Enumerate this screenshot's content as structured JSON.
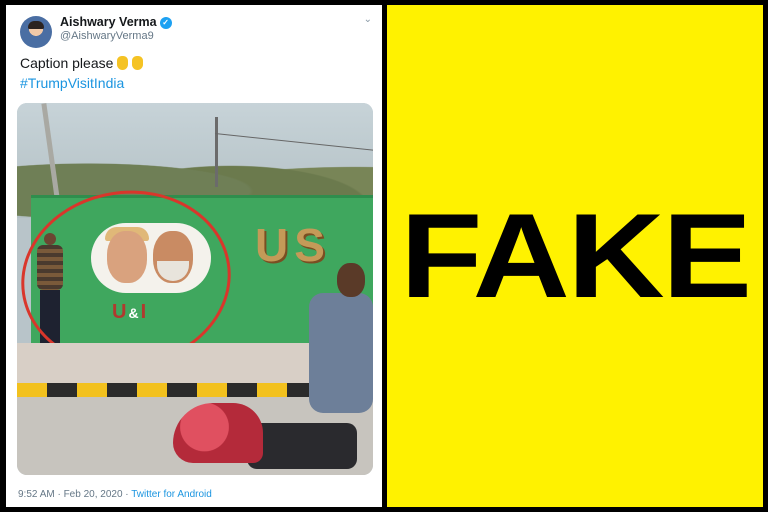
{
  "tweet": {
    "display_name": "Aishwary Verma",
    "handle": "@AishwaryVerma9",
    "text": "Caption please",
    "hashtag": "#TrumpVisitIndia",
    "timestamp": "9:52 AM · Feb 20, 2020 ·",
    "source": "Twitter for Android",
    "photo_text": {
      "ui": "U",
      "amp": "&",
      "i": "I",
      "us": "US"
    },
    "accent_color": "#1b95e0"
  },
  "verdict": {
    "label": "FAKE",
    "background": "#fff200"
  }
}
